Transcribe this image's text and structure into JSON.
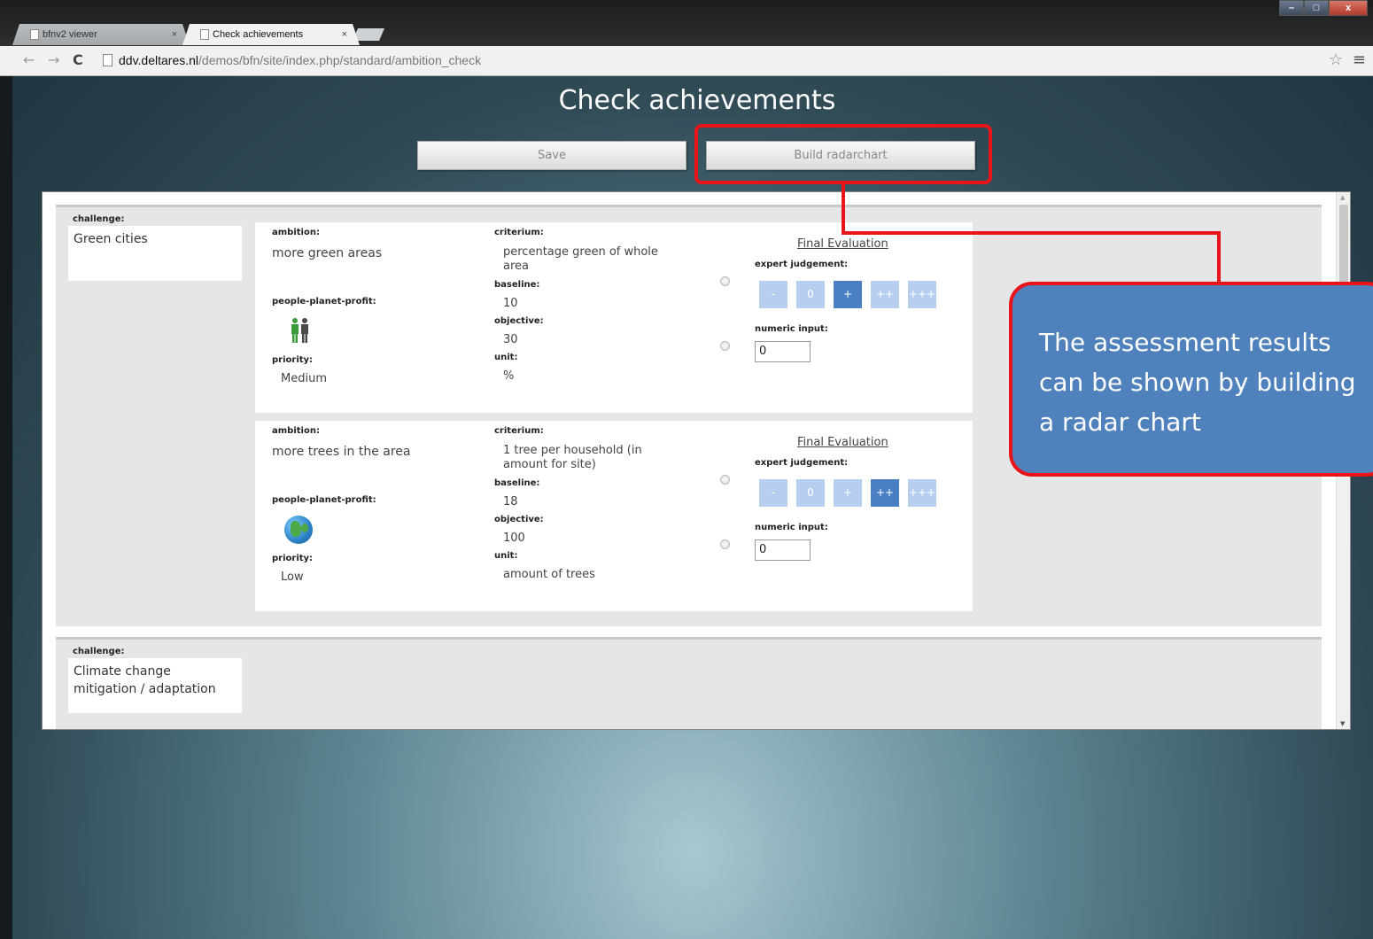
{
  "browser": {
    "tabs": [
      {
        "label": "bfnv2 viewer",
        "close": "×"
      },
      {
        "label": "Check achievements",
        "close": "×"
      }
    ],
    "window_controls": {
      "minimize": "–",
      "maximize": "□",
      "close": "x"
    },
    "url_host": "ddv.deltares.nl",
    "url_path": "/demos/bfn/site/index.php/standard/ambition_check"
  },
  "page": {
    "title": "Check achievements",
    "save_label": "Save",
    "radar_label": "Build radarchart"
  },
  "labels": {
    "challenge": "challenge:",
    "ambition": "ambition:",
    "people_planet_profit": "people-planet-profit:",
    "priority": "priority:",
    "criterium": "criterium:",
    "baseline": "baseline:",
    "objective": "objective:",
    "unit": "unit:",
    "final_evaluation": "Final Evaluation",
    "expert_judgement": "expert judgement:",
    "numeric_input": "numeric input:"
  },
  "scale_options": [
    "-",
    "0",
    "+",
    "++",
    "+++"
  ],
  "challenges": [
    {
      "name": "Green cities",
      "ambitions": [
        {
          "ambition": "more green areas",
          "ppp_icon": "people-icon",
          "priority": "Medium",
          "criterium": "percentage green of whole area",
          "baseline": "10",
          "objective": "30",
          "unit": "%",
          "selected_judgement": "+",
          "numeric_value": "0"
        },
        {
          "ambition": "more trees in the area",
          "ppp_icon": "planet-icon",
          "priority": "Low",
          "criterium": "1 tree per household (in amount for site)",
          "baseline": "18",
          "objective": "100",
          "unit": "amount of trees",
          "selected_judgement": "++",
          "numeric_value": "0"
        }
      ]
    },
    {
      "name": "Climate change mitigation / adaptation"
    }
  ],
  "callout": {
    "line1": "The assessment results",
    "line2": "can be shown by building",
    "line3": "a radar chart"
  },
  "colors": {
    "callout_bg": "#4f81bd",
    "highlight": "#e8141a",
    "scale_selected": "#4a7fc4",
    "scale_default": "#b6cff0"
  }
}
